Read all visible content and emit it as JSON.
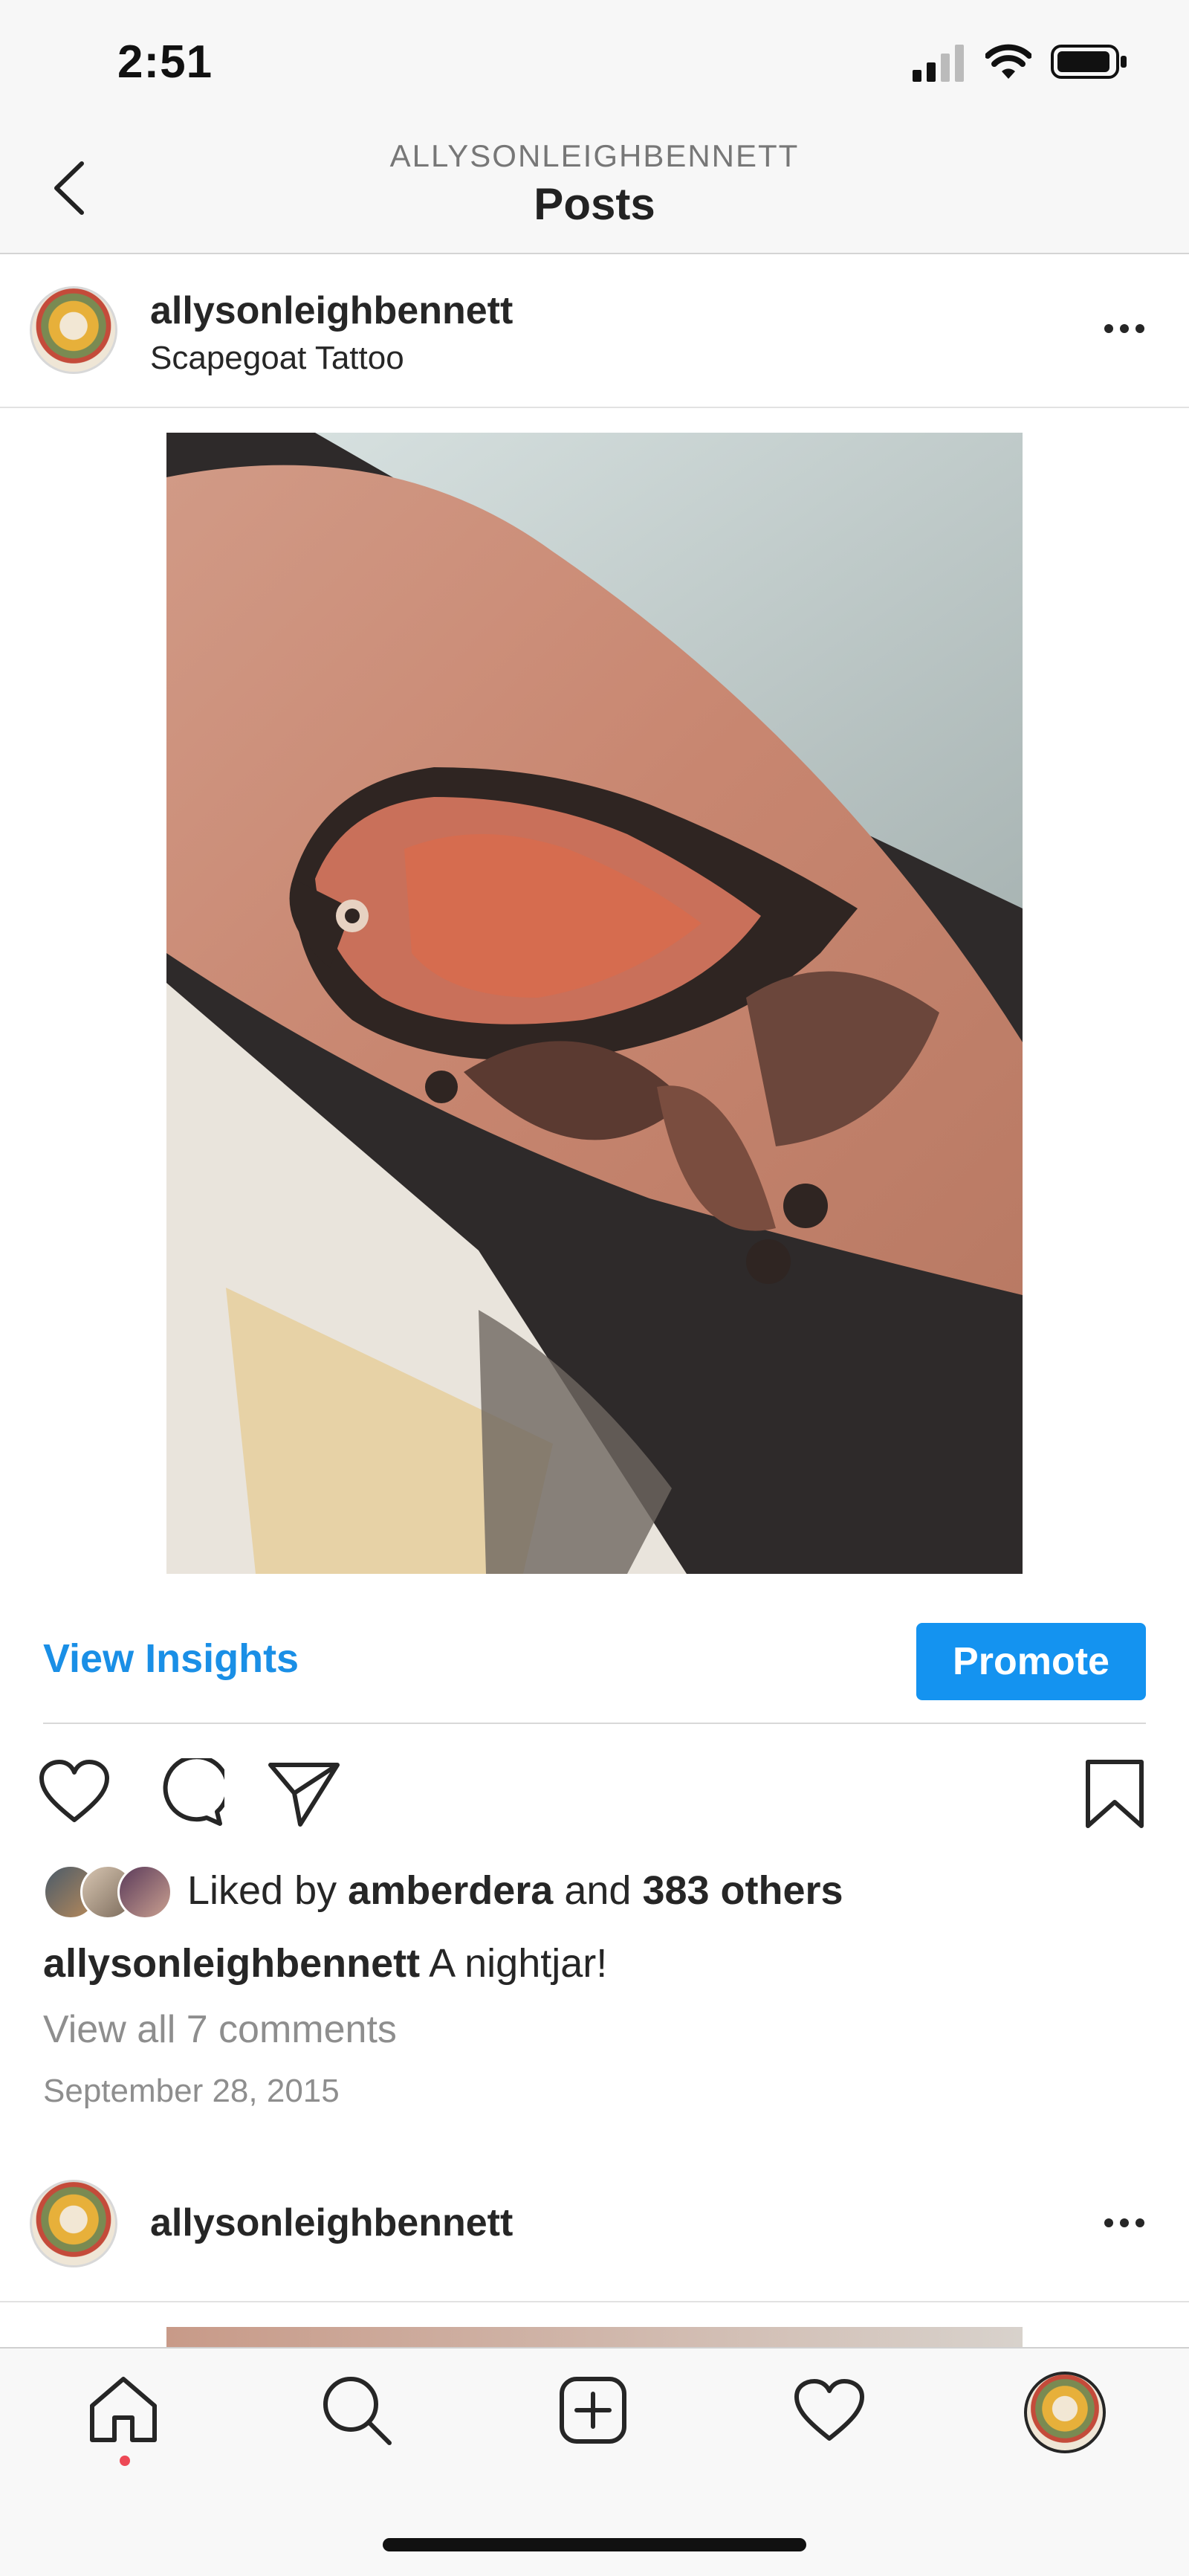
{
  "status_bar": {
    "time": "2:51"
  },
  "header": {
    "subtitle": "ALLYSONLEIGHBENNETT",
    "title": "Posts"
  },
  "post": {
    "username": "allysonleighbennett",
    "location": "Scapegoat Tattoo",
    "insights_label": "View Insights",
    "promote_label": "Promote",
    "likes_prefix": "Liked by",
    "liked_by_user": "amberdera",
    "likes_conj": "and",
    "likes_others": "383 others",
    "caption_user": "allysonleighbennett",
    "caption_text": "A nightjar!",
    "view_comments": "View all 7 comments",
    "date": "September 28, 2015"
  },
  "next_post": {
    "username": "allysonleighbennett"
  },
  "colors": {
    "accent_blue": "#1493f0",
    "link_blue": "#1a8fe6",
    "notification_red": "#ed4956"
  },
  "icons": {
    "back": "chevron-left-icon",
    "like": "heart-icon",
    "comment": "comment-icon",
    "share": "paper-plane-icon",
    "save": "bookmark-icon",
    "nav_home": "home-icon",
    "nav_search": "search-icon",
    "nav_add": "plus-square-icon",
    "nav_activity": "heart-icon",
    "nav_profile": "avatar"
  }
}
